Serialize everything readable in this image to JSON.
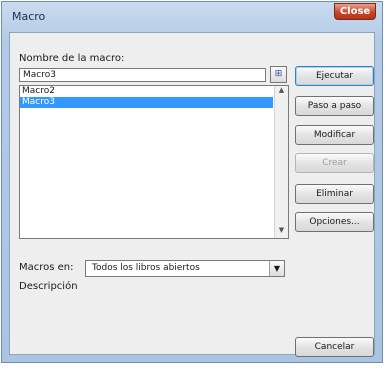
{
  "window": {
    "title": "Macro",
    "close_label": "Close"
  },
  "form": {
    "name_label": "Nombre de la macro:",
    "name_value": "Macro3",
    "macros_in_label": "Macros en:",
    "macros_in_value": "Todos los libros abiertos",
    "description_label": "Descripción"
  },
  "macro_list": [
    {
      "name": "Macro2",
      "selected": false
    },
    {
      "name": "Macro3",
      "selected": true
    }
  ],
  "buttons": {
    "run": "Ejecutar",
    "step_into": "Paso a paso",
    "edit": "Modificar",
    "create": "Crear",
    "delete": "Eliminar",
    "options": "Opciones...",
    "cancel": "Cancelar"
  },
  "colors": {
    "selection": "#3399ff",
    "titlebar": "#b3cbe6",
    "close": "#c9462b"
  },
  "icons": {
    "pick": "range-picker-icon",
    "dropdown": "chevron-down-icon"
  }
}
